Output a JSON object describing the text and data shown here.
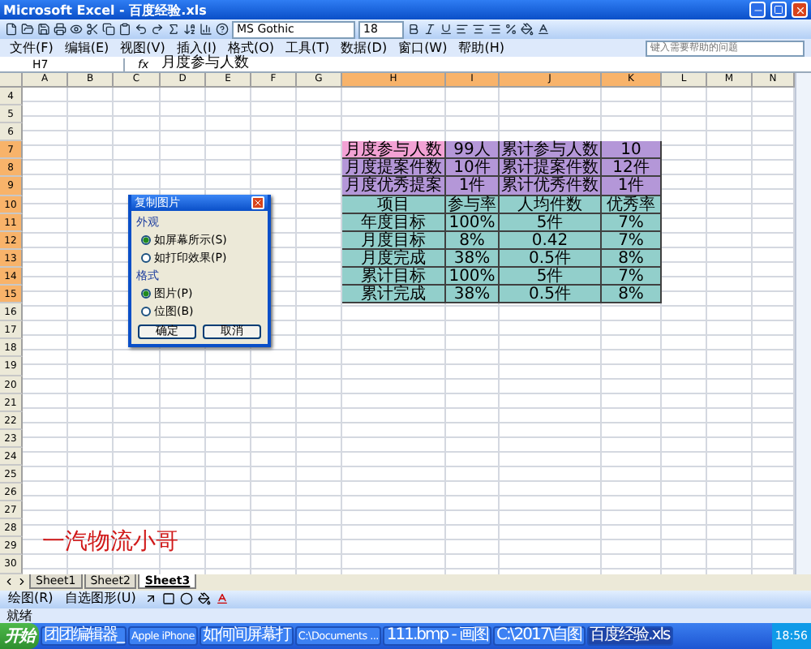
{
  "window": {
    "title": "Microsoft Excel - 百度经验.xls"
  },
  "toolbar": {
    "font": "MS Gothic",
    "size": "18"
  },
  "menu": [
    {
      "label": "文件(F)"
    },
    {
      "label": "编辑(E)"
    },
    {
      "label": "视图(V)"
    },
    {
      "label": "插入(I)"
    },
    {
      "label": "格式(O)"
    },
    {
      "label": "工具(T)"
    },
    {
      "label": "数据(D)"
    },
    {
      "label": "窗口(W)"
    },
    {
      "label": "帮助(H)"
    }
  ],
  "help_box": {
    "placeholder": "键入需要帮助的问题"
  },
  "formula_bar": {
    "name_box": "H7",
    "fx": "fx",
    "content": "月度参与人数"
  },
  "columns": [
    {
      "label": "A",
      "selected": false
    },
    {
      "label": "B",
      "selected": false
    },
    {
      "label": "C",
      "selected": false
    },
    {
      "label": "D",
      "selected": false
    },
    {
      "label": "E",
      "selected": false
    },
    {
      "label": "F",
      "selected": false
    },
    {
      "label": "G",
      "selected": false
    },
    {
      "label": "H",
      "selected": true
    },
    {
      "label": "I",
      "selected": true
    },
    {
      "label": "J",
      "selected": true
    },
    {
      "label": "K",
      "selected": true
    },
    {
      "label": "L",
      "selected": false
    },
    {
      "label": "M",
      "selected": false
    },
    {
      "label": "N",
      "selected": false
    }
  ],
  "rows": [
    {
      "number": "4",
      "selected": false
    },
    {
      "number": "5",
      "selected": false
    },
    {
      "number": "6",
      "selected": false
    },
    {
      "number": "7",
      "selected": true,
      "cells": [
        {
          "text": "月度参与人数",
          "color": "#f2a2d4"
        },
        {
          "text": "99人",
          "color": "#b497d8"
        },
        {
          "text": "累计参与人数",
          "color": "#b497d8"
        },
        {
          "text": "10",
          "color": "#b497d8"
        }
      ]
    },
    {
      "number": "8",
      "selected": true,
      "cells": [
        {
          "text": "月度提案件数",
          "color": "#b497d8"
        },
        {
          "text": "10件",
          "color": "#b497d8"
        },
        {
          "text": "累计提案件数",
          "color": "#b497d8"
        },
        {
          "text": "12件",
          "color": "#b497d8"
        }
      ]
    },
    {
      "number": "9",
      "selected": true,
      "cells": [
        {
          "text": "月度优秀提案",
          "color": "#b497d8"
        },
        {
          "text": "1件",
          "color": "#b497d8"
        },
        {
          "text": "累计优秀件数",
          "color": "#b497d8"
        },
        {
          "text": "1件",
          "color": "#b497d8"
        }
      ]
    },
    {
      "number": "10",
      "selected": true,
      "cells": [
        {
          "text": "项目",
          "color": "#92cfcb"
        },
        {
          "text": "参与率",
          "color": "#92cfcb"
        },
        {
          "text": "人均件数",
          "color": "#92cfcb"
        },
        {
          "text": "优秀率",
          "color": "#92cfcb"
        }
      ]
    },
    {
      "number": "11",
      "selected": true,
      "cells": [
        {
          "text": "年度目标",
          "color": "#92cfcb"
        },
        {
          "text": "100%",
          "color": "#92cfcb"
        },
        {
          "text": "5件",
          "color": "#92cfcb"
        },
        {
          "text": "7%",
          "color": "#92cfcb"
        }
      ]
    },
    {
      "number": "12",
      "selected": true,
      "cells": [
        {
          "text": "月度目标",
          "color": "#92cfcb"
        },
        {
          "text": "8%",
          "color": "#92cfcb"
        },
        {
          "text": "0.42",
          "color": "#92cfcb"
        },
        {
          "text": "7%",
          "color": "#92cfcb"
        }
      ]
    },
    {
      "number": "13",
      "selected": true,
      "cells": [
        {
          "text": "月度完成",
          "color": "#92cfcb"
        },
        {
          "text": "38%",
          "color": "#92cfcb"
        },
        {
          "text": "0.5件",
          "color": "#92cfcb"
        },
        {
          "text": "8%",
          "color": "#92cfcb"
        }
      ]
    },
    {
      "number": "14",
      "selected": true,
      "cells": [
        {
          "text": "累计目标",
          "color": "#92cfcb"
        },
        {
          "text": "100%",
          "color": "#92cfcb"
        },
        {
          "text": "5件",
          "color": "#92cfcb"
        },
        {
          "text": "7%",
          "color": "#92cfcb"
        }
      ]
    },
    {
      "number": "15",
      "selected": true,
      "cells": [
        {
          "text": "累计完成",
          "color": "#92cfcb"
        },
        {
          "text": "38%",
          "color": "#92cfcb"
        },
        {
          "text": "0.5件",
          "color": "#92cfcb"
        },
        {
          "text": "8%",
          "color": "#92cfcb"
        }
      ]
    },
    {
      "number": "16",
      "selected": false
    },
    {
      "number": "17",
      "selected": false
    },
    {
      "number": "18",
      "selected": false
    },
    {
      "number": "19",
      "selected": false
    },
    {
      "number": "20",
      "selected": false
    },
    {
      "number": "21",
      "selected": false
    },
    {
      "number": "22",
      "selected": false
    },
    {
      "number": "23",
      "selected": false
    },
    {
      "number": "24",
      "selected": false
    },
    {
      "number": "25",
      "selected": false
    },
    {
      "number": "26",
      "selected": false
    },
    {
      "number": "27",
      "selected": false
    },
    {
      "number": "28",
      "selected": false
    },
    {
      "number": "29",
      "selected": false
    },
    {
      "number": "30",
      "selected": false
    }
  ],
  "overlay_text": "一汽物流小哥",
  "dialog": {
    "title": "复制图片",
    "groups": [
      {
        "label": "外观",
        "options": [
          {
            "label": "如屏幕所示(S)",
            "selected": true
          },
          {
            "label": "如打印效果(P)",
            "selected": false
          }
        ]
      },
      {
        "label": "格式",
        "options": [
          {
            "label": "图片(P)",
            "selected": true
          },
          {
            "label": "位图(B)",
            "selected": false
          }
        ]
      }
    ],
    "buttons": [
      "确定",
      "取消"
    ]
  },
  "sheet_tabs": [
    {
      "label": "Sheet1",
      "selected": false
    },
    {
      "label": "Sheet2",
      "selected": false
    },
    {
      "label": "Sheet3",
      "selected": true
    }
  ],
  "drawing_toolbar": [
    "绘图(R)",
    "自选图形(U)"
  ],
  "status": "就绪",
  "taskbar": {
    "start": "开始",
    "items": [
      {
        "label": "团团编辑器_",
        "selected": false
      },
      {
        "label": "Apple iPhone",
        "selected": false
      },
      {
        "label": "如何间屏幕打",
        "selected": false
      },
      {
        "label": "C:\\Documents ...",
        "selected": false
      },
      {
        "label": "111.bmp - 画图",
        "selected": false
      },
      {
        "label": "C:\\2017\\自图",
        "selected": false
      },
      {
        "label": "百度经验.xls",
        "selected": true
      }
    ],
    "clock": "18:56"
  }
}
